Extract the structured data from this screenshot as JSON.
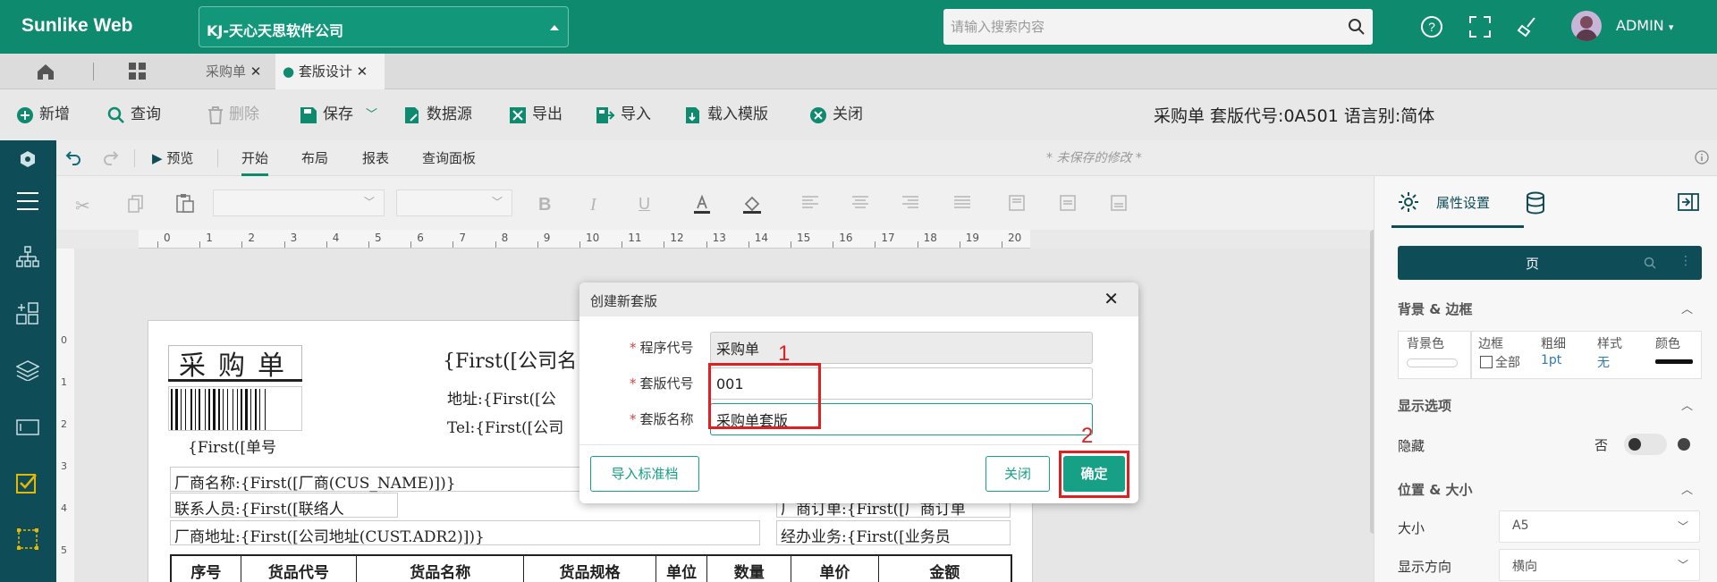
{
  "app": {
    "logo": "Sunlike Web",
    "company": "KJ-天心天思软件公司",
    "search_placeholder": "请输入搜索内容",
    "user": "ADMIN"
  },
  "tabs": [
    {
      "label": "采购单",
      "active": false
    },
    {
      "label": "套版设计",
      "active": true
    }
  ],
  "toolbar": {
    "new": "新增",
    "query": "查询",
    "delete": "删除",
    "save": "保存",
    "datasource": "数据源",
    "export": "导出",
    "import": "导入",
    "load_template": "载入模版",
    "close": "关闭"
  },
  "docinfo": "采购单 套版代号:0A501 语言别:简体",
  "ribbon": {
    "preview": "预览",
    "tabs": [
      "开始",
      "布局",
      "报表",
      "查询面板"
    ],
    "unsaved": "* 未保存的修改 *"
  },
  "ruler": [
    "0",
    "1",
    "2",
    "3",
    "4",
    "5",
    "6",
    "7",
    "8",
    "9",
    "10",
    "11",
    "12",
    "13",
    "14",
    "15",
    "16",
    "17",
    "18",
    "19",
    "20"
  ],
  "vruler": [
    "0",
    "1",
    "2",
    "3",
    "4",
    "5"
  ],
  "report": {
    "title": "采购单",
    "barcode_label": "{First([单号",
    "company": "{First([公司名",
    "address": "地址:{First([公",
    "tel": "Tel:{First([公司",
    "vendor_name": "厂商名称:{First([厂商(CUS_NAME)])}",
    "contact": "联系人员:{First([联络人",
    "vendor_addr": "厂商地址:{First([公司地址(CUST.ADR2)])}",
    "vendor_order": "厂商订单:{First([厂商订单",
    "handler": "经办业务:{First([业务员",
    "columns": [
      "序号",
      "货品代号",
      "货品名称",
      "货品规格",
      "单位",
      "数量",
      "单价",
      "金额"
    ]
  },
  "panel": {
    "tab_props": "属性设置",
    "page": "页",
    "bg_border": "背景 & 边框",
    "bg_color": "背景色",
    "border": "边框",
    "thickness": "粗细",
    "style": "样式",
    "color": "颜色",
    "all": "全部",
    "thickness_val": "1pt",
    "style_val": "无",
    "display": "显示选项",
    "hidden": "隐藏",
    "hidden_val": "否",
    "pos_size": "位置 & 大小",
    "size": "大小",
    "size_val": "A5",
    "orientation": "显示方向",
    "orientation_val": "横向"
  },
  "modal": {
    "title": "创建新套版",
    "program_label": "程序代号",
    "program_value": "采购单",
    "code_label": "套版代号",
    "code_value": "001",
    "name_label": "套版名称",
    "name_value": "采购单套版",
    "import_btn": "导入标准档",
    "close_btn": "关闭",
    "ok_btn": "确定",
    "marker1": "1",
    "marker2": "2"
  },
  "colors": {
    "brand": "#0e8a6e",
    "sidebar": "#0e4c57",
    "primary_button": "#16a085",
    "annotation": "#e02020"
  }
}
